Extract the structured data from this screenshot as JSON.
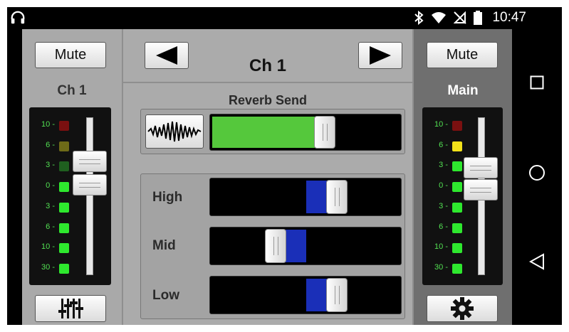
{
  "status_bar": {
    "time": "10:47",
    "icons": [
      "headphones-icon",
      "bluetooth-icon",
      "wifi-icon",
      "no-signal-icon",
      "battery-icon"
    ]
  },
  "left_channel": {
    "mute_label": "Mute",
    "name": "Ch 1",
    "meter_labels": [
      "10",
      "6",
      "3",
      "0",
      "3",
      "6",
      "10",
      "30"
    ],
    "meter_colors": [
      "#7a1010",
      "#6e6a18",
      "#1f5f1f",
      "#2ee82e",
      "#2ee82e",
      "#2ee82e",
      "#2ee82e",
      "#2ee82e"
    ],
    "bottom_icon": "mixer-sliders-icon"
  },
  "center": {
    "prev_icon": "left-arrow-icon",
    "next_icon": "right-arrow-icon",
    "channel_title": "Ch 1",
    "reverb_label": "Reverb Send",
    "reverb_icon": "waveform-icon",
    "reverb_level": 0.61,
    "eq": [
      {
        "label": "High",
        "value": 0.68
      },
      {
        "label": "Mid",
        "value": 0.32
      },
      {
        "label": "Low",
        "value": 0.68
      }
    ],
    "colors": {
      "reverb_fill": "#55c83c",
      "eq_fill": "#1a2fb8"
    }
  },
  "right_channel": {
    "mute_label": "Mute",
    "name": "Main",
    "meter_labels": [
      "10",
      "6",
      "3",
      "0",
      "3",
      "6",
      "10",
      "30"
    ],
    "meter_colors": [
      "#7a1010",
      "#f2e21a",
      "#2ee82e",
      "#2ee82e",
      "#2ee82e",
      "#2ee82e",
      "#2ee82e",
      "#2ee82e"
    ],
    "bottom_icon": "gear-icon"
  },
  "nav": {
    "icons": [
      "recents-square-icon",
      "home-circle-icon",
      "back-triangle-icon"
    ]
  }
}
